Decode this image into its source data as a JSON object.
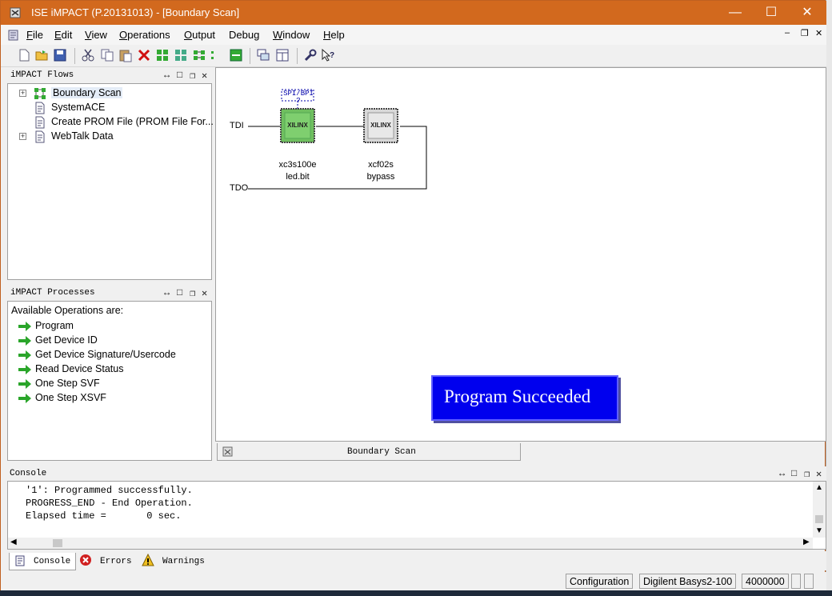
{
  "window": {
    "title": "ISE iMPACT (P.20131013) - [Boundary Scan]"
  },
  "menu": [
    {
      "label": "File",
      "u": "F",
      "rest": "ile"
    },
    {
      "label": "Edit",
      "u": "E",
      "rest": "dit"
    },
    {
      "label": "View",
      "u": "V",
      "rest": "iew"
    },
    {
      "label": "Operations",
      "u": "O",
      "rest": "perations"
    },
    {
      "label": "Output",
      "u": "O",
      "rest": "utput"
    },
    {
      "label": "Debug",
      "u": "",
      "rest": "Debug"
    },
    {
      "label": "Window",
      "u": "W",
      "rest": "indow"
    },
    {
      "label": "Help",
      "u": "H",
      "rest": "elp"
    }
  ],
  "flows": {
    "header": "iMPACT Flows",
    "items": [
      {
        "label": "Boundary Scan",
        "icon": "boundary-scan-icon",
        "expandable": true
      },
      {
        "label": "SystemACE",
        "icon": "document-icon",
        "expandable": false
      },
      {
        "label": "Create PROM File (PROM File For...",
        "icon": "document-icon",
        "expandable": false
      },
      {
        "label": "WebTalk Data",
        "icon": "document-icon",
        "expandable": true
      }
    ]
  },
  "processes": {
    "header": "iMPACT Processes",
    "intro": "Available Operations are:",
    "items": [
      "Program",
      "Get Device ID",
      "Get Device Signature/Usercode",
      "Read Device Status",
      "One Step SVF",
      "One Step XSVF"
    ]
  },
  "chain": {
    "tdi": "TDI",
    "tdo": "TDO",
    "spi_label": "SPI/BPI",
    "spi_q": "?",
    "devices": [
      {
        "name": "xc3s100e",
        "file": "led.bit",
        "logo": "XILINX",
        "color": "#6fbf5f"
      },
      {
        "name": "xcf02s",
        "file": "bypass",
        "logo": "XILINX",
        "color": "#d8d8d8"
      }
    ],
    "success": "Program Succeeded"
  },
  "doc_tab": {
    "label": "Boundary Scan"
  },
  "console": {
    "header": "Console",
    "lines": [
      "'1': Programmed successfully.",
      "PROGRESS_END - End Operation.",
      "Elapsed time =       0 sec."
    ]
  },
  "bottom_tabs": [
    "Console",
    "Errors",
    "Warnings"
  ],
  "status": {
    "mode": "Configuration",
    "cable": "Digilent Basys2-100",
    "speed": "4000000"
  },
  "colors": {
    "titlebar": "#d2691e",
    "success_bg": "#0000ee",
    "arrow": "#2aa52a"
  }
}
